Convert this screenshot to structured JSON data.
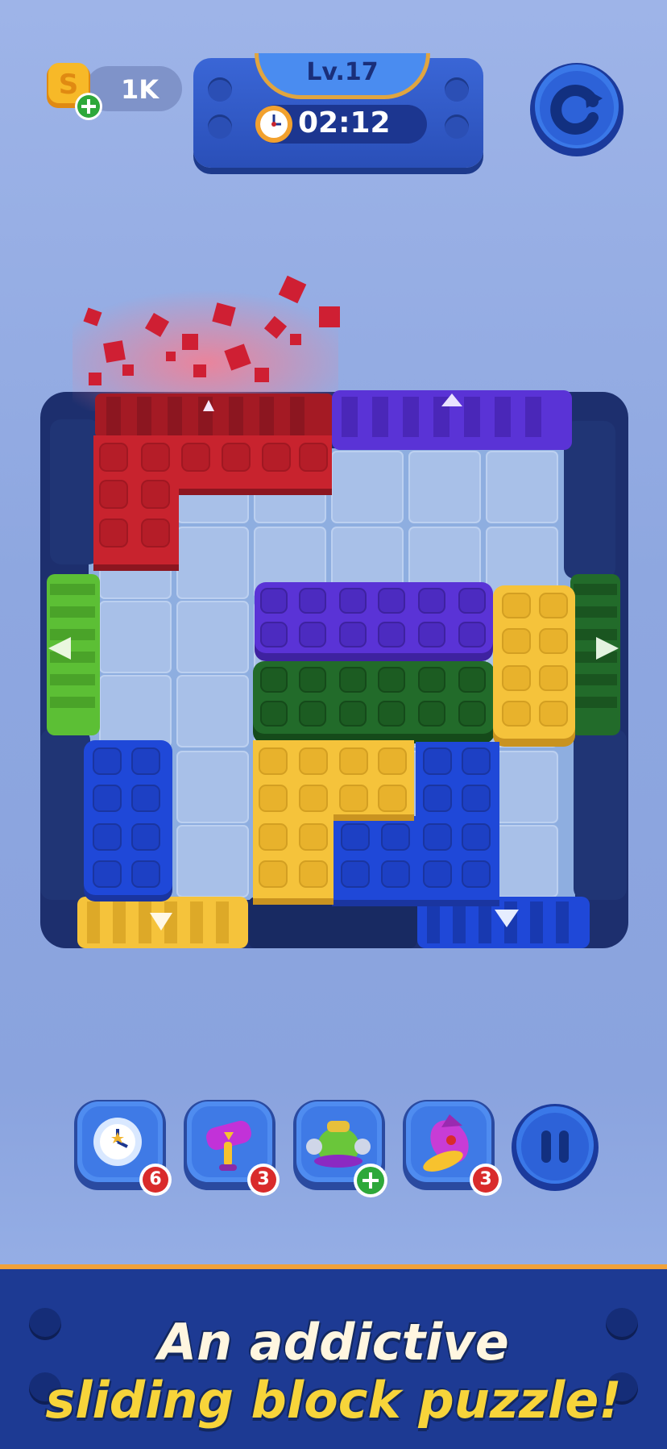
{
  "hud": {
    "coins": "1K",
    "level": "Lv.17",
    "timer": "02:12"
  },
  "boosters": [
    {
      "name": "freeze-clock",
      "count": "6"
    },
    {
      "name": "hammer",
      "count": "3"
    },
    {
      "name": "vacuum",
      "count": "+"
    },
    {
      "name": "rocket",
      "count": "3"
    }
  ],
  "banner": {
    "line1": "An addictive",
    "line2": "sliding block puzzle!"
  },
  "colors": {
    "red": "#c8232e",
    "purple": "#5a33d6",
    "green_dark": "#226b2a",
    "green_light": "#5cbf35",
    "yellow": "#f5c33b",
    "blue": "#1f48d8",
    "wall": "#1f3270",
    "tile": "#a9bee6"
  },
  "icons": [
    "coin-icon",
    "add-coin-icon",
    "timer-icon",
    "restart-icon",
    "pause-icon",
    "up-arrow-icon",
    "left-arrow-icon",
    "right-arrow-icon",
    "down-arrow-icon"
  ]
}
